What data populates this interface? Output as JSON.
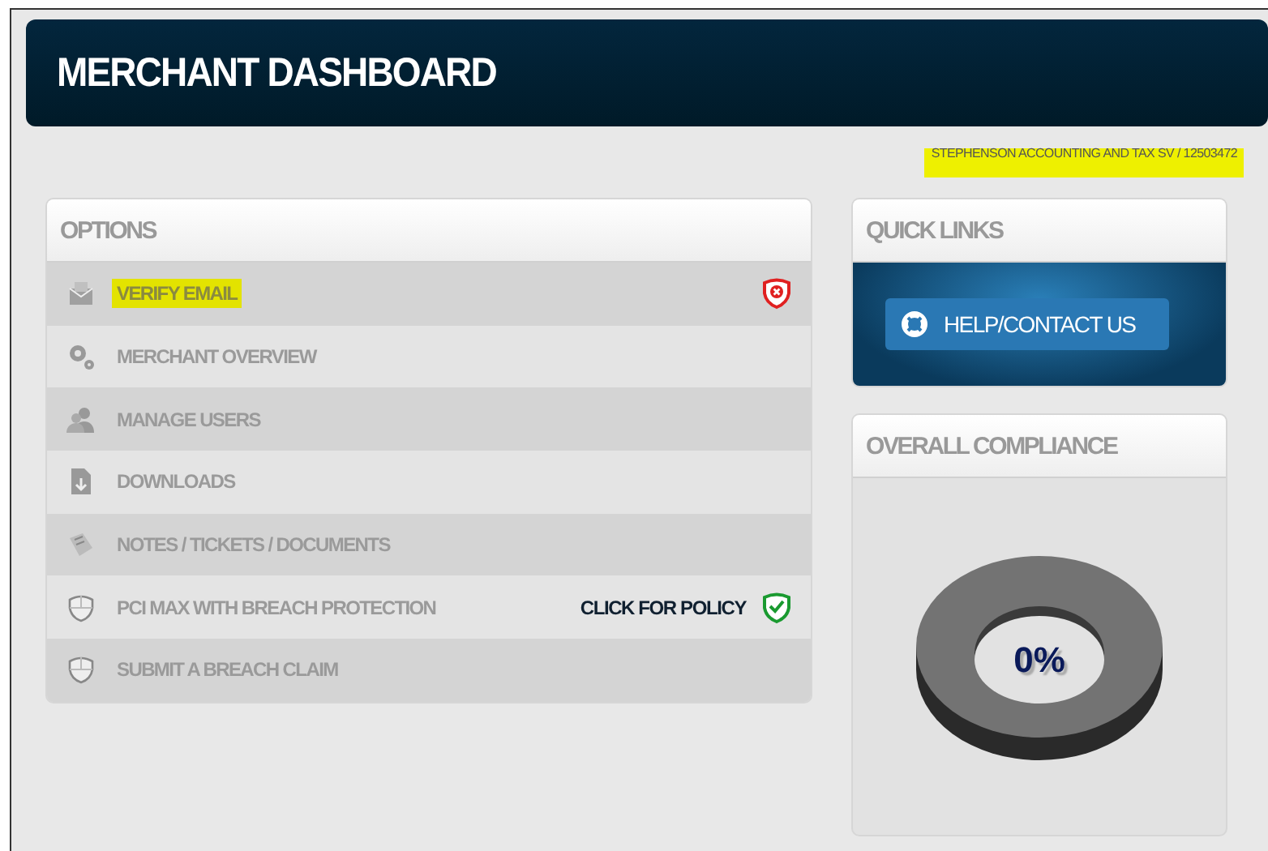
{
  "header": {
    "title": "MERCHANT DASHBOARD"
  },
  "account": {
    "text": "STEPHENSON ACCOUNTING AND TAX SV / 12503472",
    "highlighted": true
  },
  "options": {
    "title": "OPTIONS",
    "items": [
      {
        "kind": "error",
        "label": "VERIFY EMAIL",
        "highlighted": true
      },
      {
        "kind": "plain",
        "label": "MERCHANT OVERVIEW",
        "highlighted": false
      },
      {
        "kind": "plain",
        "label": "MANAGE USERS",
        "highlighted": false
      },
      {
        "kind": "plain",
        "label": "DOWNLOADS",
        "highlighted": false
      },
      {
        "kind": "plain",
        "label": "NOTES / TICKETS / DOCUMENTS",
        "highlighted": false
      },
      {
        "kind": "ok",
        "label": "PCI MAX WITH BREACH PROTECTION",
        "highlighted": false,
        "link": "CLICK FOR POLICY"
      },
      {
        "kind": "plain",
        "label": "SUBMIT A BREACH CLAIM",
        "highlighted": false
      }
    ]
  },
  "quick_links": {
    "title": "QUICK LINKS",
    "buttons": [
      "HELP/CONTACT US"
    ]
  },
  "compliance": {
    "title": "OVERALL COMPLIANCE",
    "reading": "0%"
  }
}
